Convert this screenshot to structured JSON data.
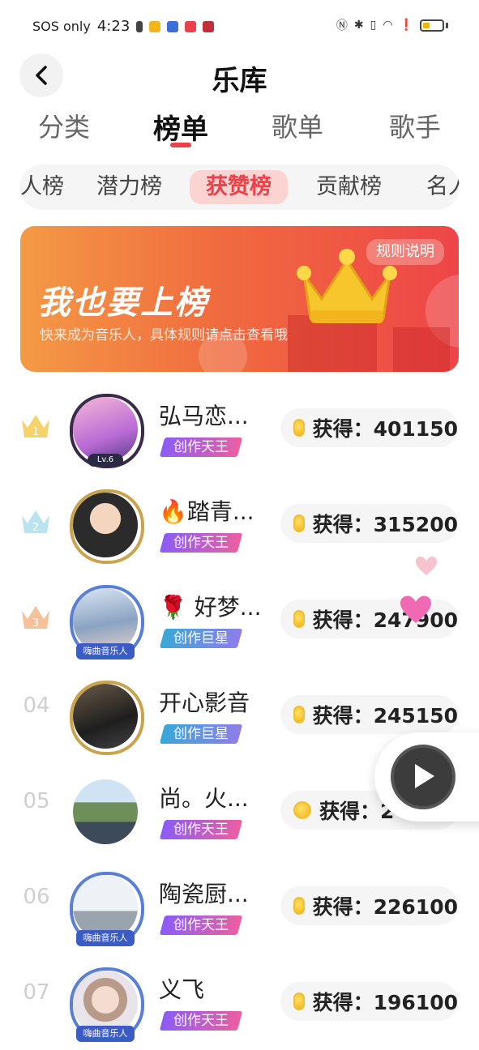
{
  "statusbar": {
    "carrier": "SOS only",
    "time": "4:23"
  },
  "header": {
    "title": "乐库"
  },
  "main_tabs": [
    "分类",
    "榜单",
    "歌单",
    "歌手"
  ],
  "sub_tabs": [
    "人榜",
    "潜力榜",
    "获赞榜",
    "贡献榜",
    "名人"
  ],
  "banner": {
    "rules": "规则说明",
    "title": "我也要上榜",
    "subtitle": "快来成为音乐人，具体规则请点击查看哦"
  },
  "frames": {
    "haiqu": "嗨曲音乐人",
    "lv": "Lv.6"
  },
  "rows": [
    {
      "rank": "1",
      "name": "弘马恋...",
      "badge": "创作天王",
      "score": "获得：401150"
    },
    {
      "rank": "2",
      "name": "🔥踏青...",
      "badge": "创作天王",
      "score": "获得：315200"
    },
    {
      "rank": "3",
      "name": "🌹 好梦...",
      "badge": "创作巨星",
      "score": "获得：247900"
    },
    {
      "rank": "04",
      "name": "开心影音",
      "badge": "创作巨星",
      "score": "获得：245150"
    },
    {
      "rank": "05",
      "name": "尚。火...",
      "badge": "创作天王",
      "score": "获得：2"
    },
    {
      "rank": "06",
      "name": "陶瓷厨...",
      "badge": "创作天王",
      "score": "获得：226100"
    },
    {
      "rank": "07",
      "name": "义飞",
      "badge": "创作天王",
      "score": "获得：196100"
    }
  ],
  "colors": {
    "accent": "#e8424b",
    "gold": "#f2c94c",
    "silver": "#a8d8ea",
    "bronze": "#f2b27a"
  }
}
